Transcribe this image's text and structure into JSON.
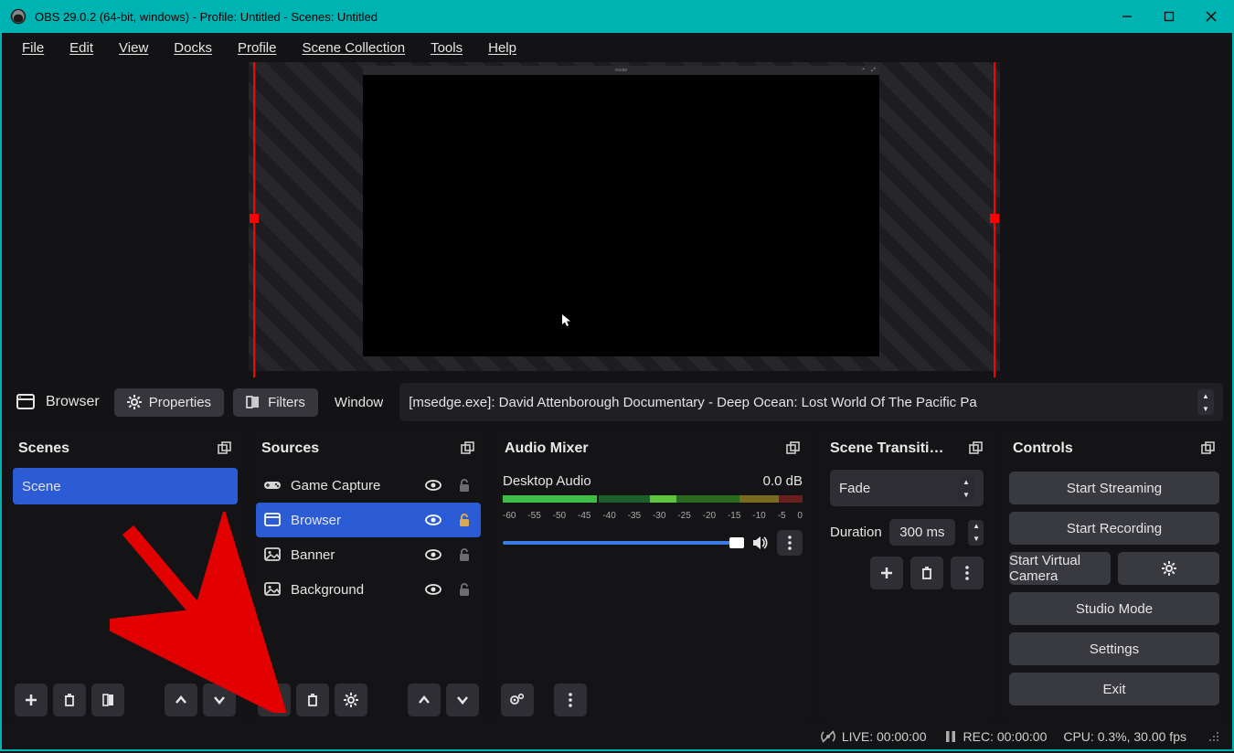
{
  "titlebar": {
    "title": "OBS 29.0.2 (64-bit, windows) - Profile: Untitled - Scenes: Untitled"
  },
  "menu": {
    "file": "File",
    "edit": "Edit",
    "view": "View",
    "docks": "Docks",
    "profile": "Profile",
    "scene_collection": "Scene Collection",
    "tools": "Tools",
    "help": "Help"
  },
  "preview": {
    "tab_label": "ocean"
  },
  "context": {
    "source_type": "Browser",
    "properties": "Properties",
    "filters": "Filters",
    "field_label": "Window",
    "field_value": "[msedge.exe]: David Attenborough Documentary - Deep Ocean: Lost World Of The Pacific Pa"
  },
  "scenes": {
    "title": "Scenes",
    "items": [
      {
        "label": "Scene",
        "selected": true
      }
    ]
  },
  "sources": {
    "title": "Sources",
    "items": [
      {
        "label": "Game Capture",
        "icon": "gamepad",
        "selected": false,
        "locked": false
      },
      {
        "label": "Browser",
        "icon": "window",
        "selected": true,
        "locked": true
      },
      {
        "label": "Banner",
        "icon": "image",
        "selected": false,
        "locked": false
      },
      {
        "label": "Background",
        "icon": "image",
        "selected": false,
        "locked": false
      }
    ]
  },
  "mixer": {
    "title": "Audio Mixer",
    "channel_name": "Desktop Audio",
    "channel_db": "0.0 dB",
    "ticks": [
      "-60",
      "-55",
      "-50",
      "-45",
      "-40",
      "-35",
      "-30",
      "-25",
      "-20",
      "-15",
      "-10",
      "-5",
      "0"
    ]
  },
  "transitions": {
    "title": "Scene Transiti…",
    "current": "Fade",
    "duration_label": "Duration",
    "duration_value": "300 ms"
  },
  "controls": {
    "title": "Controls",
    "start_streaming": "Start Streaming",
    "start_recording": "Start Recording",
    "start_virtual_camera": "Start Virtual Camera",
    "studio_mode": "Studio Mode",
    "settings": "Settings",
    "exit": "Exit"
  },
  "status": {
    "live": "LIVE: 00:00:00",
    "rec": "REC: 00:00:00",
    "cpu": "CPU: 0.3%, 30.00 fps"
  }
}
